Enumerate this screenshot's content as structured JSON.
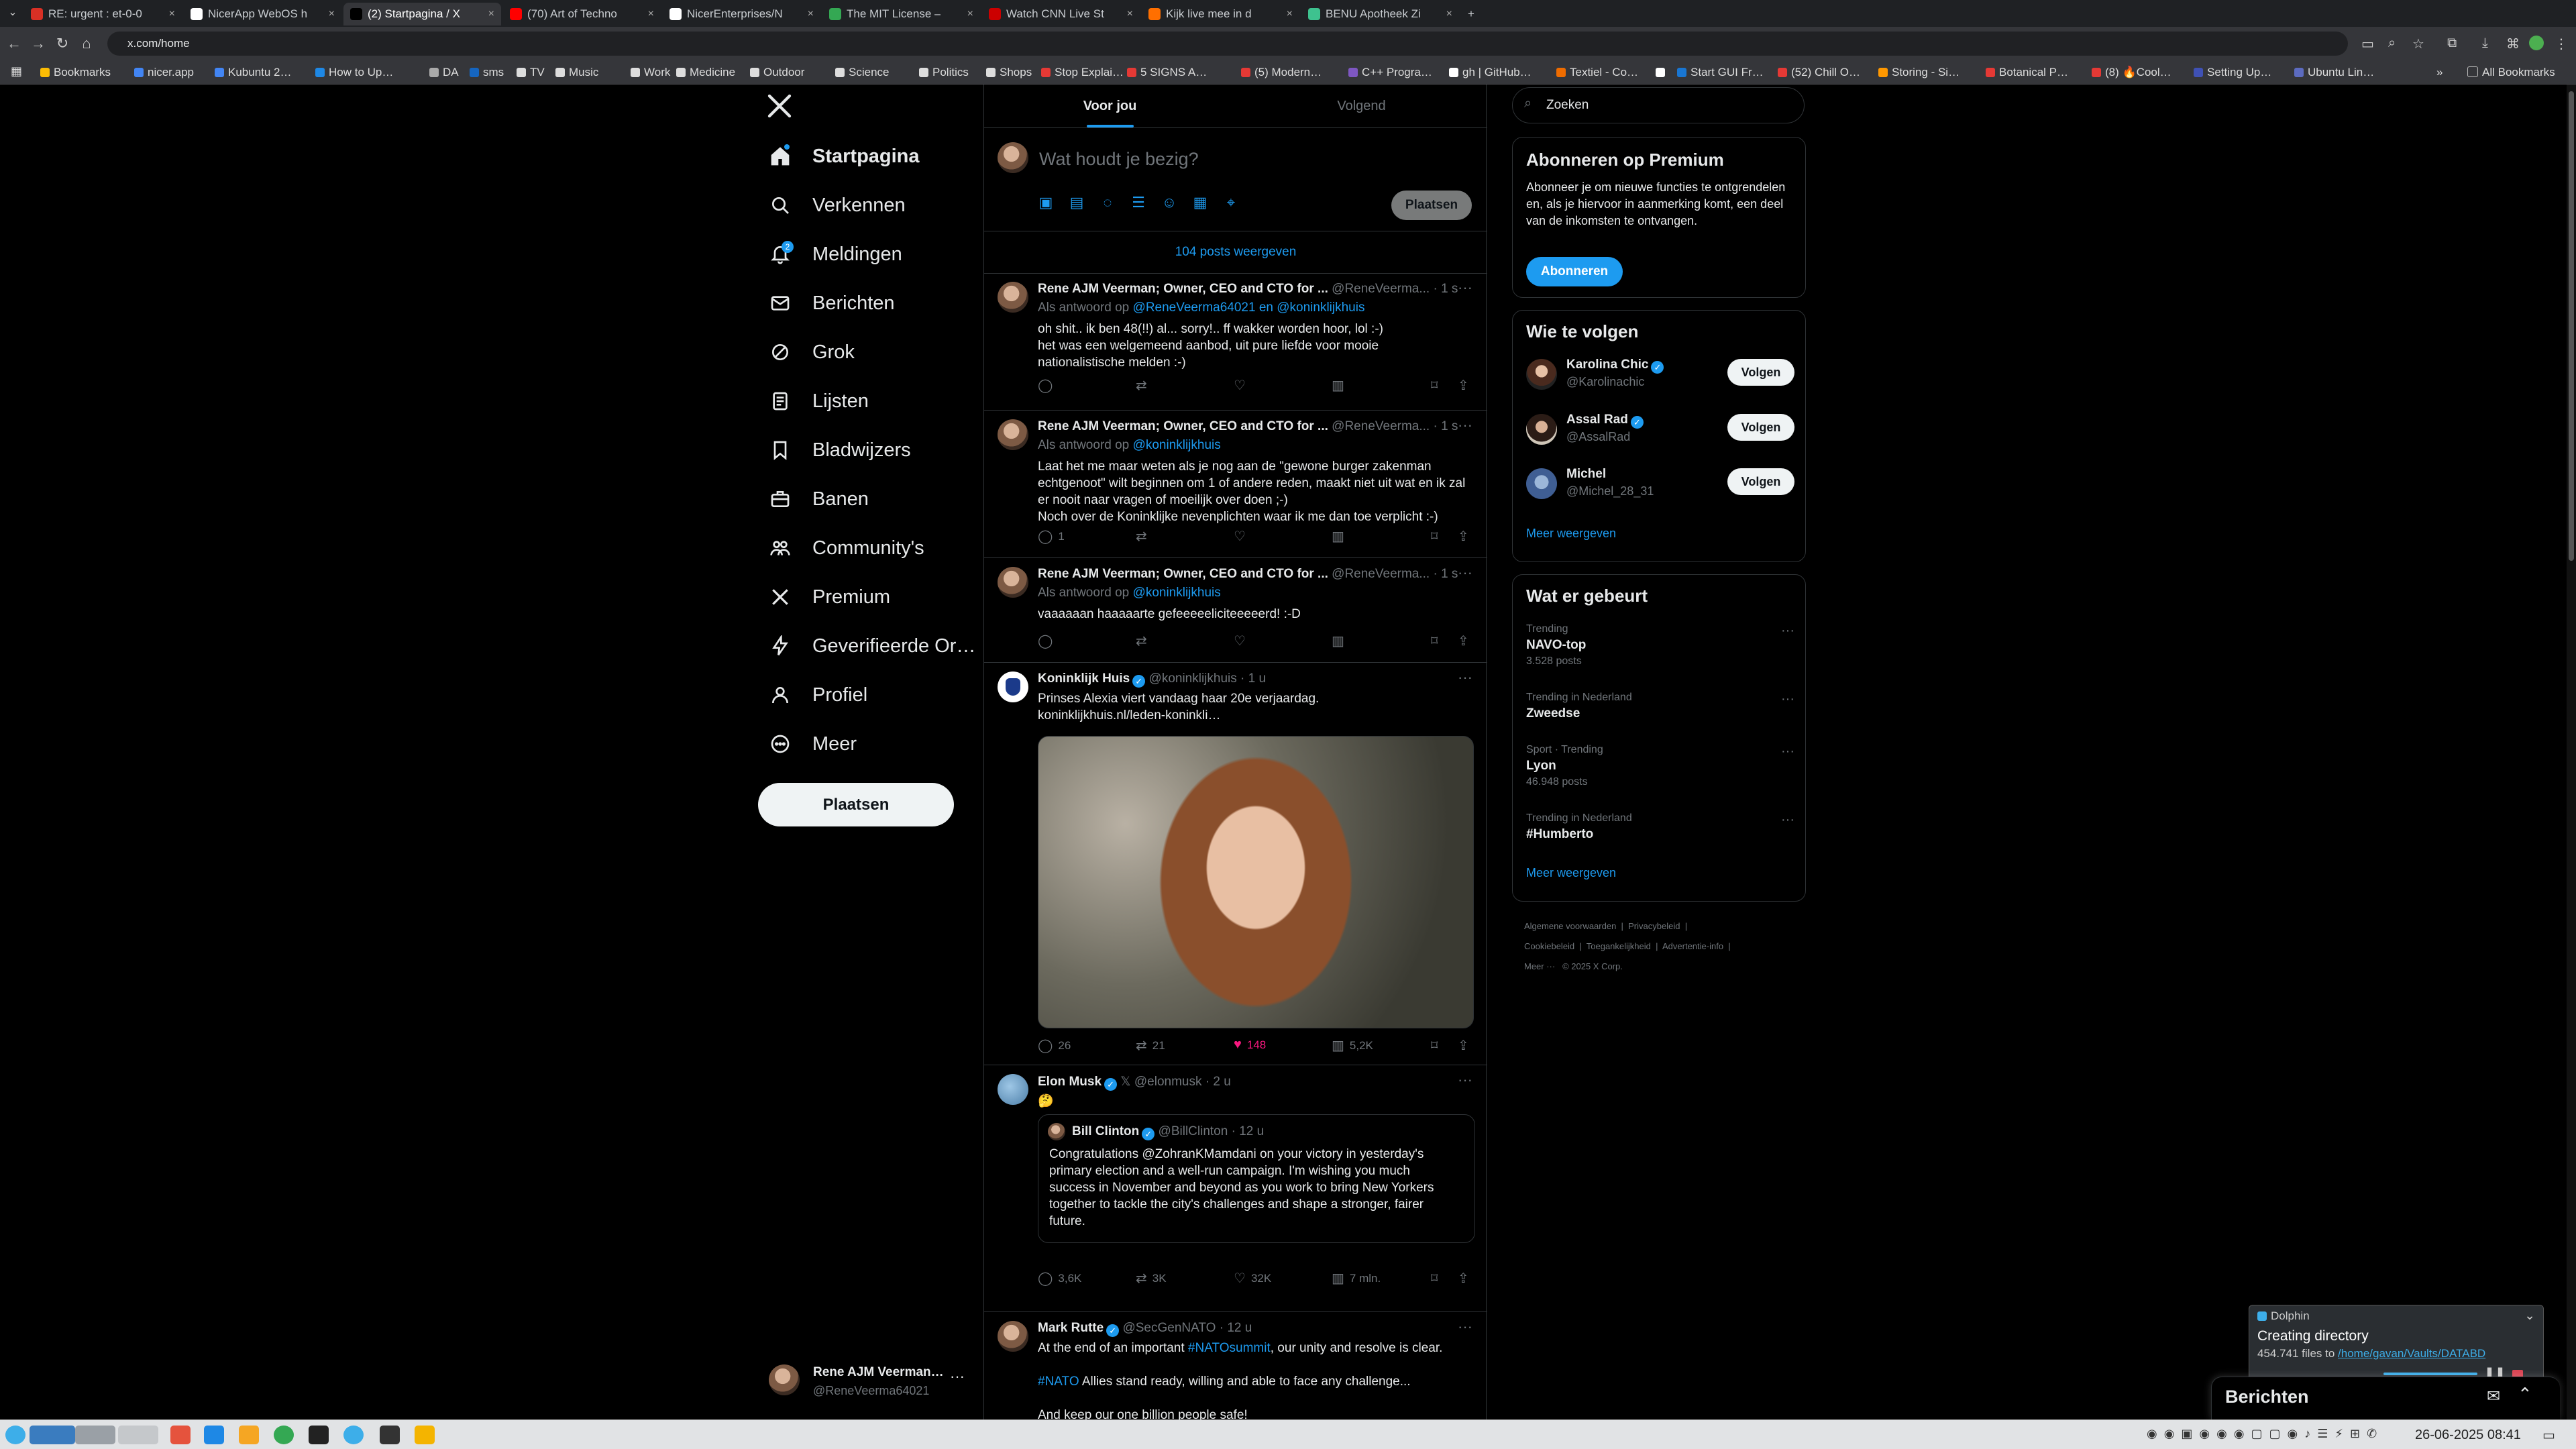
{
  "browser": {
    "tabs": [
      {
        "title": "RE: urgent : et-0-0",
        "favicon_color": "#d93025"
      },
      {
        "title": "NicerApp WebOS h",
        "favicon_color": "#ffffff"
      },
      {
        "title": "(2) Startpagina / X",
        "favicon_color": "#000000",
        "active": true
      },
      {
        "title": "(70) Art of Techno",
        "favicon_color": "#ff0000"
      },
      {
        "title": "NicerEnterprises/N",
        "favicon_color": "#ffffff"
      },
      {
        "title": "The MIT License – ",
        "favicon_color": "#34a853"
      },
      {
        "title": "Watch CNN Live St",
        "favicon_color": "#cc0000"
      },
      {
        "title": "Kijk live mee in d",
        "favicon_color": "#ff6f00"
      },
      {
        "title": "BENU Apotheek Zi",
        "favicon_color": "#3ec28f"
      }
    ],
    "new_tab": "+",
    "url": "x.com/home",
    "bookmarks": [
      "Bookmarks",
      "nicer.app",
      "Kubuntu 2…",
      "How to Up…",
      "DA",
      "sms",
      "TV",
      "Music",
      "Work",
      "Medicine",
      "Outdoor",
      "Science",
      "Politics",
      "Shops",
      "Stop Explai…",
      "5 SIGNS A…",
      "(5) Modern…",
      "C++ Progra…",
      "gh | GitHub…",
      "Textiel - Co…",
      "",
      "Start GUI Fr…",
      "(52) Chill O…",
      "Storing - Si…",
      "Botanical P…",
      "(8) 🔥Cool…",
      "Setting Up…",
      "Ubuntu Lin…"
    ],
    "bookmarks_overflow": "»",
    "all_bookmarks": "All Bookmarks"
  },
  "sidebar": {
    "items": [
      {
        "label": "Startpagina",
        "icon": "home-icon"
      },
      {
        "label": "Verkennen",
        "icon": "search-icon"
      },
      {
        "label": "Meldingen",
        "icon": "bell-icon",
        "badge": "2"
      },
      {
        "label": "Berichten",
        "icon": "mail-icon"
      },
      {
        "label": "Grok",
        "icon": "grok-icon"
      },
      {
        "label": "Lijsten",
        "icon": "list-icon"
      },
      {
        "label": "Bladwijzers",
        "icon": "bookmark-icon"
      },
      {
        "label": "Banen",
        "icon": "briefcase-icon"
      },
      {
        "label": "Community's",
        "icon": "people-icon"
      },
      {
        "label": "Premium",
        "icon": "x-logo-icon"
      },
      {
        "label": "Geverifieerde Or…",
        "icon": "lightning-icon"
      },
      {
        "label": "Profiel",
        "icon": "person-icon"
      },
      {
        "label": "Meer",
        "icon": "more-circle-icon"
      }
    ],
    "post_button": "Plaatsen",
    "account": {
      "name": "Rene AJM Veerman…",
      "handle": "@ReneVeerma64021",
      "more": "···"
    }
  },
  "feed": {
    "tabs": [
      "Voor jou",
      "Volgend"
    ],
    "composer_placeholder": "Wat houdt je bezig?",
    "composer_post": "Plaatsen",
    "show_posts": "104 posts weergeven",
    "posts": [
      {
        "name": "Rene AJM Veerman; Owner, CEO and CTO for ...",
        "handle": "@ReneVeerma...",
        "time": "· 1 s",
        "reply_prefix": "Als antwoord op",
        "reply_to": "@ReneVeerma64021 en @koninklijkhuis",
        "text": "oh shit.. ik ben 48(!!) al... sorry!.. ff wakker worden hoor, lol :-)\nhet was een welgemeend aanbod, uit pure liefde voor mooie\nnationalistische melden :-)",
        "replies": "",
        "reposts": "",
        "likes": "",
        "views": ""
      },
      {
        "name": "Rene AJM Veerman; Owner, CEO and CTO for ...",
        "handle": "@ReneVeerma...",
        "time": "· 1 s",
        "reply_prefix": "Als antwoord op",
        "reply_to": "@koninklijkhuis",
        "text": "Laat het me maar weten als je nog aan de \"gewone burger zakenman\nechtgenoot\" wilt beginnen om 1 of andere reden, maakt niet uit wat en ik zal\ner nooit naar vragen of moeilijk over doen ;-)\nNoch over de Koninklijke nevenplichten waar ik me dan toe verplicht :-)",
        "replies": "1",
        "reposts": "",
        "likes": "",
        "views": ""
      },
      {
        "name": "Rene AJM Veerman; Owner, CEO and CTO for ...",
        "handle": "@ReneVeerma...",
        "time": "· 1 s",
        "reply_prefix": "Als antwoord op",
        "reply_to": "@koninklijkhuis",
        "text": "vaaaaaan haaaaarte gefeeeeeliciteeeeerd! :-D",
        "replies": "",
        "reposts": "",
        "likes": "",
        "views": ""
      },
      {
        "name": "Koninklijk Huis",
        "handle": "@koninklijkhuis",
        "time": "· 1 u",
        "text": "Prinses Alexia viert vandaag haar 20e verjaardag.",
        "link": "koninklijkhuis.nl/leden-koninkli…",
        "replies": "26",
        "reposts": "21",
        "likes": "148",
        "views": "5,2K"
      },
      {
        "name": "Elon Musk",
        "handle": "@elonmusk",
        "time": "· 2 u",
        "text": "🤔",
        "quote": {
          "name": "Bill Clinton",
          "handle": "@BillClinton",
          "time": "· 12 u",
          "text": "Congratulations @ZohranKMamdani on your victory in yesterday's\nprimary election and a well-run campaign. I'm wishing you much\nsuccess in November and beyond as you work to bring New Yorkers\ntogether to tackle the city's challenges and shape a stronger, fairer\nfuture."
        },
        "replies": "3,6K",
        "reposts": "3K",
        "likes": "32K",
        "views": "7 mln."
      },
      {
        "name": "Mark Rutte",
        "handle": "@SecGenNATO",
        "time": "· 12 u",
        "line1_pre": "At the end of an important",
        "line1_tag": "#NATOsummit",
        "line1_post": ", our unity and resolve is clear.",
        "line2_tag": "#NATO",
        "line2_post": "Allies stand ready, willing and able to face any challenge...",
        "line3": "And keep our one billion people safe!"
      }
    ]
  },
  "right": {
    "search_placeholder": "Zoeken",
    "premium": {
      "title": "Abonneren op Premium",
      "text": "Abonneer je om nieuwe functies te ontgrendelen en, als je hiervoor in aanmerking komt, een deel van de inkomsten te ontvangen.",
      "button": "Abonneren"
    },
    "who_to_follow": {
      "title": "Wie te volgen",
      "people": [
        {
          "name": "Karolina Chic",
          "handle": "@Karolinachic",
          "verified": true
        },
        {
          "name": "Assal Rad",
          "handle": "@AssalRad",
          "verified": true
        },
        {
          "name": "Michel",
          "handle": "@Michel_28_31",
          "verified": false
        }
      ],
      "follow_label": "Volgen",
      "more": "Meer weergeven"
    },
    "trends": {
      "title": "Wat er gebeurt",
      "items": [
        {
          "context": "Trending",
          "name": "NAVO-top",
          "posts": "3.528 posts"
        },
        {
          "context": "Trending in Nederland",
          "name": "Zweedse",
          "posts": ""
        },
        {
          "context": "Sport · Trending",
          "name": "Lyon",
          "posts": "46.948 posts"
        },
        {
          "context": "Trending in Nederland",
          "name": "#Humberto",
          "posts": ""
        }
      ],
      "more": "Meer weergeven"
    },
    "footer": {
      "line1": [
        "Algemene voorwaarden",
        "Privacybeleid"
      ],
      "line2": [
        "Cookiebeleid",
        "Toegankelijkheid",
        "Advertentie-info"
      ],
      "line3": [
        "Meer ···",
        "© 2025 X Corp."
      ]
    }
  },
  "messages_drawer": {
    "title": "Berichten"
  },
  "dolphin": {
    "app": "Dolphin",
    "title": "Creating directory",
    "count": "454.741 files to",
    "path": "/home/gavan/Vaults/DATABD"
  },
  "taskbar": {
    "datetime": "26-06-2025  08:41"
  },
  "colors": {
    "accent": "#1d9bf0",
    "like": "#f91880",
    "bg": "#000000",
    "border": "#2f3336"
  }
}
